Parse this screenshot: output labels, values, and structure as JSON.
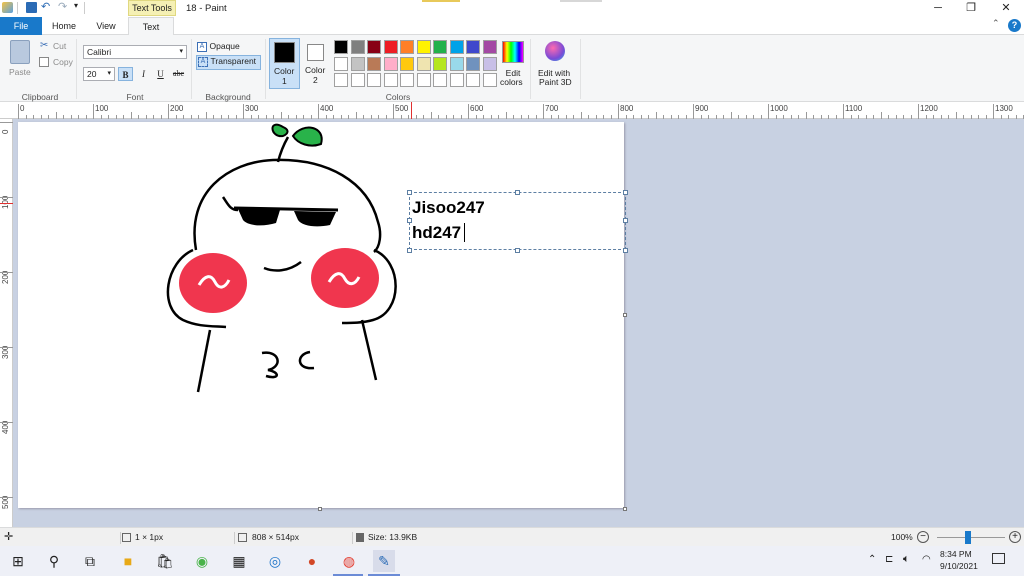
{
  "titlebar": {
    "context_tab": "Text Tools",
    "title": "18 - Paint",
    "buttons": {
      "minimize": "─",
      "restore": "❐",
      "close": "✕"
    }
  },
  "tabs": {
    "file": "File",
    "home": "Home",
    "view": "View",
    "text": "Text"
  },
  "ribbon": {
    "clipboard": {
      "paste": "Paste",
      "cut": "Cut",
      "copy": "Copy",
      "group": "Clipboard"
    },
    "font": {
      "family": "Calibri",
      "size": "20",
      "bold": "B",
      "italic": "I",
      "underline": "U",
      "strike": "abc",
      "group": "Font"
    },
    "background": {
      "opaque": "Opaque",
      "transparent": "Transparent",
      "group": "Background"
    },
    "colors": {
      "color1_label": "Color",
      "color1_num": "1",
      "color2_label": "Color",
      "color2_num": "2",
      "group": "Colors",
      "edit_colors_1": "Edit",
      "edit_colors_2": "colors",
      "edit3d_1": "Edit with",
      "edit3d_2": "Paint 3D",
      "palette_row1": [
        "#000000",
        "#7f7f7f",
        "#880015",
        "#ed1c24",
        "#ff7f27",
        "#fff200",
        "#22b14c",
        "#00a2e8",
        "#3f48cc",
        "#a349a4"
      ],
      "palette_row2": [
        "#ffffff",
        "#c3c3c3",
        "#b97a57",
        "#ffaec9",
        "#ffc90e",
        "#efe4b0",
        "#b5e61d",
        "#99d9ea",
        "#7092be",
        "#c8bfe7"
      ],
      "color1": "#000000",
      "color2": "#ffffff"
    }
  },
  "ruler": {
    "h_labels": [
      "0",
      "100",
      "200",
      "300",
      "400",
      "500",
      "600",
      "700",
      "800",
      "900",
      "1000",
      "1100",
      "1200",
      "1300"
    ],
    "v_labels": [
      "0",
      "100",
      "200",
      "300",
      "400",
      "500"
    ]
  },
  "canvas": {
    "text_lines": [
      "Jisoo247",
      "hd247"
    ]
  },
  "status": {
    "pen_size": "1 × 1px",
    "dimensions": "808 × 514px",
    "size": "Size: 13.9KB",
    "zoom": "100%"
  },
  "taskbar": {
    "time": "8:34 PM",
    "date": "9/10/2021"
  }
}
